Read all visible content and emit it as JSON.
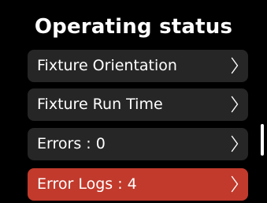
{
  "header": {
    "title": "Operating status"
  },
  "menu": {
    "items": [
      {
        "label": "Fixture Orientation",
        "icon": "chevron-right-icon"
      },
      {
        "label": "Fixture Run Time",
        "icon": "chevron-right-icon"
      },
      {
        "label": "Errors : 0",
        "icon": "chevron-right-icon"
      },
      {
        "label": "Error Logs : 4",
        "icon": "chevron-right-icon",
        "highlighted": true
      }
    ]
  },
  "colors": {
    "background": "#000000",
    "item_background": "#262626",
    "alert_background": "#c13a2c",
    "text": "#ffffff"
  }
}
